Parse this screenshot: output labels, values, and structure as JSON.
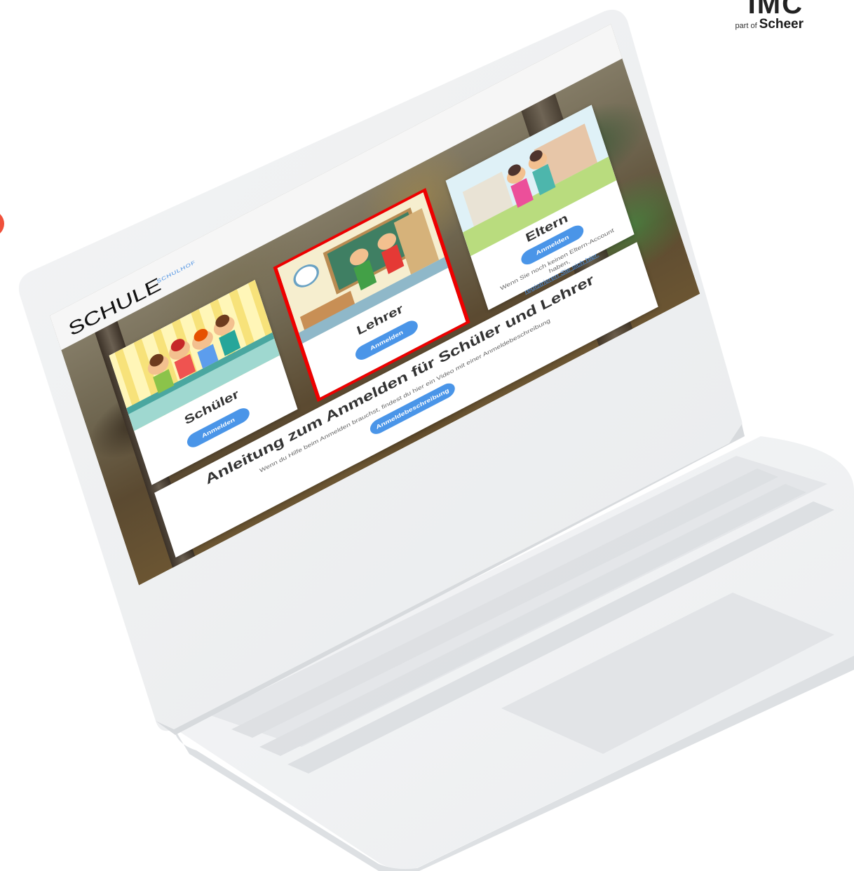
{
  "brand": {
    "mark": "IMC",
    "sub_prefix": "part of",
    "sub_name": "Scheer"
  },
  "site": {
    "logo": "SCHULE",
    "nav_link": "SCHULHOF"
  },
  "cards": {
    "schueler": {
      "title": "Schüler",
      "button": "Anmelden"
    },
    "lehrer": {
      "title": "Lehrer",
      "button": "Anmelden"
    },
    "eltern": {
      "title": "Eltern",
      "button": "Anmelden",
      "note": "Wenn Sie noch keinen Eltern-Account haben,",
      "note_link": "registrieren Sie sich hier."
    }
  },
  "guide": {
    "title": "Anleitung zum Anmelden für Schüler und Lehrer",
    "text": "Wenn du Hilfe beim Anmelden brauchst, findest du hier ein Video mit einer Anmeldebeschreibung",
    "button": "Anmeldebeschreibung"
  },
  "colors": {
    "accent": "#4a95e8",
    "selection": "#e00000",
    "brand_red": "#f0513b"
  }
}
